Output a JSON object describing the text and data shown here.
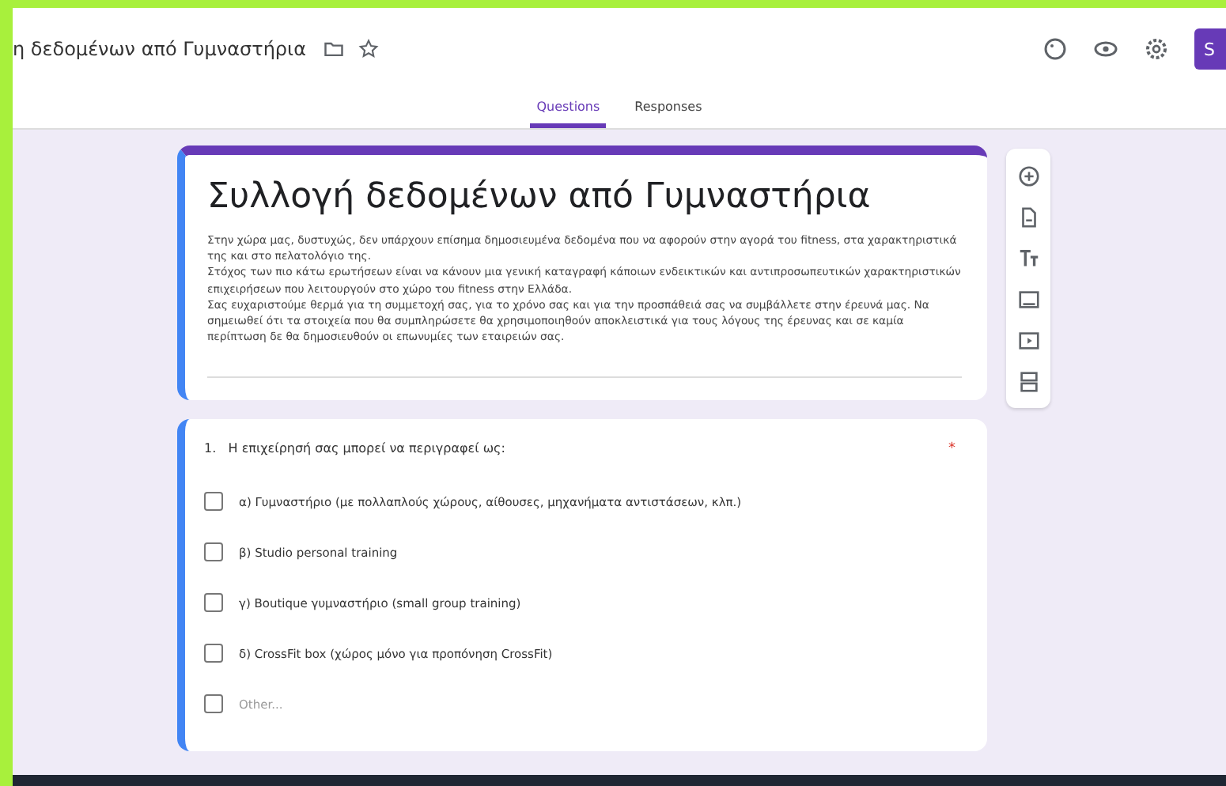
{
  "header": {
    "title": "η δεδομένων από Γυμναστήρια",
    "send_button": "S"
  },
  "tabs": [
    {
      "label": "Questions",
      "selected": true
    },
    {
      "label": "Responses",
      "selected": false
    }
  ],
  "form": {
    "title": "Συλλογή δεδομένων από Γυμναστήρια",
    "description": "Στην χώρα μας, δυστυχώς, δεν υπάρχουν επίσημα δημοσιευμένα δεδομένα που να αφορούν στην αγορά του fitness, στα χαρακτηριστικά της και στο πελατολόγιο της.\nΣτόχος των πιο κάτω ερωτήσεων είναι να κάνουν μια γενική καταγραφή κάποιων ενδεικτικών και αντιπροσωπευτικών χαρακτηριστικών επιχειρήσεων που λειτουργούν στο χώρο του fitness στην Ελλάδα.\nΣας ευχαριστούμε θερμά για τη συμμετοχή σας, για το χρόνο σας και για την προσπάθειά σας να συμβάλλετε στην έρευνά μας. Να σημειωθεί ότι τα στοιχεία που θα συμπληρώσετε θα χρησιμοποιηθούν αποκλειστικά για τους λόγους της έρευνας και σε καμία περίπτωση δε θα δημοσιευθούν οι επωνυμίες των εταιρειών σας."
  },
  "question": {
    "number": "1.",
    "text": "Η επιχείρησή σας μπορεί να περιγραφεί ως:",
    "required_mark": "*",
    "options": [
      {
        "label": "α) Γυμναστήριο (με πολλαπλούς χώρους, αίθουσες, μηχανήματα αντιστάσεων, κλπ.)",
        "checked": false,
        "kind": "option"
      },
      {
        "label": "β) Studio personal training",
        "checked": false,
        "kind": "option"
      },
      {
        "label": "γ) Boutique γυμναστήριο (small group training)",
        "checked": false,
        "kind": "option"
      },
      {
        "label": "δ) CrossFit box (χώρος μόνο για προπόνηση CrossFit)",
        "checked": false,
        "kind": "option"
      },
      {
        "label": "Other...",
        "checked": false,
        "kind": "other"
      }
    ]
  }
}
